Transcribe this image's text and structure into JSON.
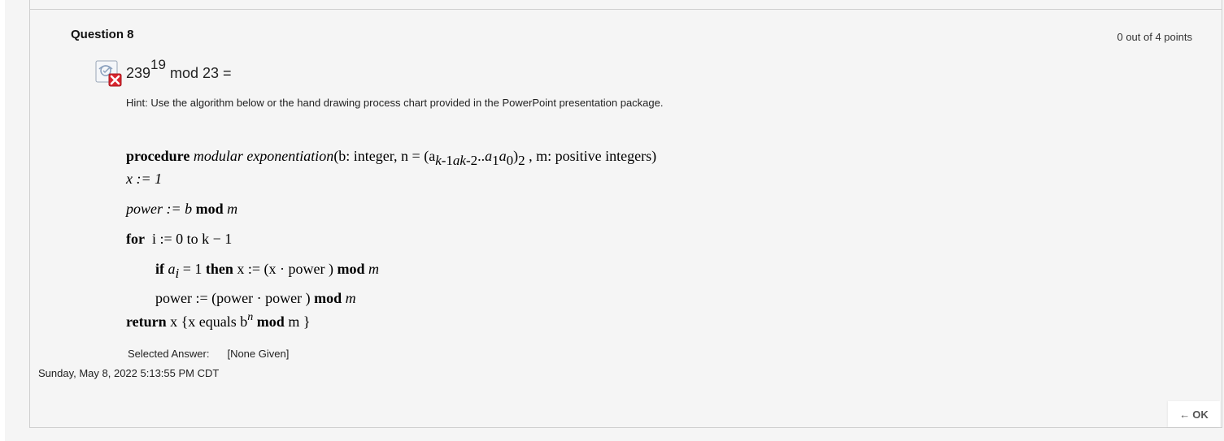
{
  "question": {
    "title": "Question 8",
    "points": "0 out of 4 points",
    "status_icon": "incorrect-x-icon",
    "status_color": "#d9262f",
    "prompt_base": "239",
    "prompt_exponent": "19",
    "prompt_rest": " mod 23 =",
    "hint": "Hint: Use the algorithm below or the hand drawing process chart provided in the PowerPoint presentation package."
  },
  "algorithm": {
    "line1_keyword": "procedure",
    "line1_name": "modular exponentiation",
    "line1_params_pre": "(b: integer, n = (a",
    "line1_params_post": ", m: positive integers)",
    "line2": "x := 1",
    "line3_var": "power := b",
    "line3_op": "mod",
    "line3_m": "m",
    "line4_keyword": "for",
    "line4_rest": "i := 0 to k − 1",
    "line5_if": "if",
    "line5_cond": "a",
    "line5_sub": "i",
    "line5_eq": "= 1",
    "line5_then": "then",
    "line5_assign": "x := (x · power )",
    "line5_mod": "mod",
    "line5_m": "m",
    "line6_assign": "power := (power · power )",
    "line6_mod": "mod",
    "line6_m": "m",
    "line7_keyword": "return",
    "line7_rest": "x {x equals b",
    "line7_exp": "n",
    "line7_mod": "mod",
    "line7_end": "m }"
  },
  "answer": {
    "label": "Selected Answer:",
    "value": "[None Given]"
  },
  "timestamp": "Sunday, May 8, 2022 5:13:55 PM CDT",
  "ok_button": {
    "arrow": "←",
    "label": "OK"
  }
}
